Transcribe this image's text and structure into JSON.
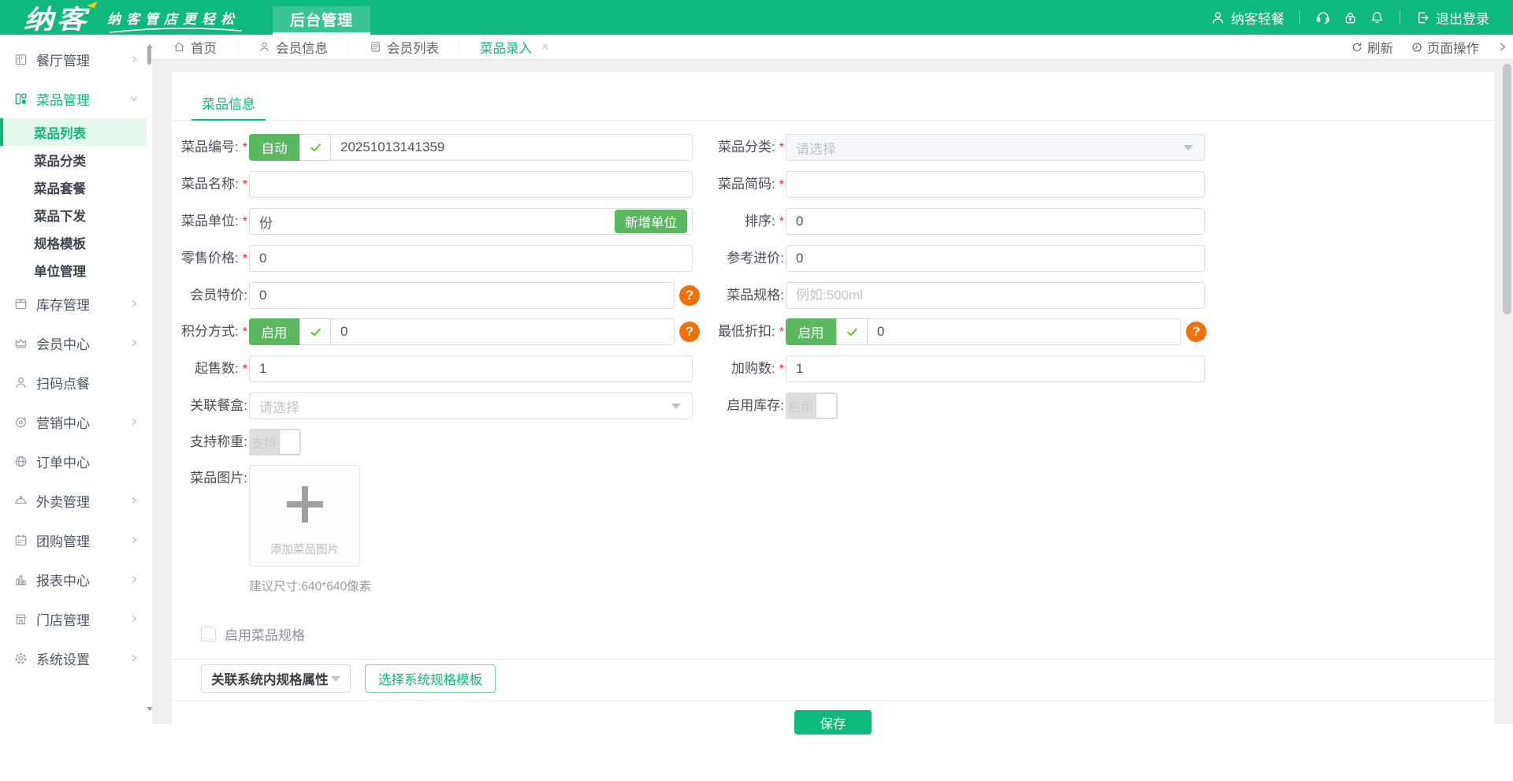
{
  "header": {
    "logo_text": "纳客",
    "tagline": "纳客管店更轻松",
    "nav_tab": "后台管理",
    "account_name": "纳客轻餐",
    "logout_label": "退出登录"
  },
  "sidebar": {
    "items": [
      {
        "label": "餐厅管理"
      },
      {
        "label": "菜品管理"
      },
      {
        "label": "库存管理"
      },
      {
        "label": "会员中心"
      },
      {
        "label": "扫码点餐"
      },
      {
        "label": "营销中心"
      },
      {
        "label": "订单中心"
      },
      {
        "label": "外卖管理"
      },
      {
        "label": "团购管理"
      },
      {
        "label": "报表中心"
      },
      {
        "label": "门店管理"
      },
      {
        "label": "系统设置"
      }
    ],
    "dish_submenu": [
      {
        "label": "菜品列表",
        "active": true
      },
      {
        "label": "菜品分类"
      },
      {
        "label": "菜品套餐"
      },
      {
        "label": "菜品下发"
      },
      {
        "label": "规格模板"
      },
      {
        "label": "单位管理"
      }
    ]
  },
  "tabbar": {
    "tabs": [
      {
        "label": "首页"
      },
      {
        "label": "会员信息"
      },
      {
        "label": "会员列表"
      },
      {
        "label": "菜品录入",
        "active": true
      }
    ],
    "refresh_label": "刷新",
    "page_ops_label": "页面操作"
  },
  "form": {
    "section_tab": "菜品信息",
    "required_marker": "*",
    "fields": {
      "code": {
        "label": "菜品编号:",
        "required": true,
        "auto_btn": "自动",
        "value": "20251013141359"
      },
      "category": {
        "label": "菜品分类:",
        "required": true,
        "placeholder": "请选择"
      },
      "name": {
        "label": "菜品名称:",
        "required": true,
        "value": ""
      },
      "short_code": {
        "label": "菜品简码:",
        "required": true,
        "value": ""
      },
      "unit": {
        "label": "菜品单位:",
        "required": true,
        "value": "份",
        "add_btn": "新增单位"
      },
      "sort": {
        "label": "排序:",
        "required": true,
        "value": "0"
      },
      "retail_price": {
        "label": "零售价格:",
        "required": true,
        "value": "0"
      },
      "ref_price": {
        "label": "参考进价:",
        "required": false,
        "value": "0"
      },
      "member_price": {
        "label": "会员特价:",
        "required": false,
        "value": "0"
      },
      "spec": {
        "label": "菜品规格:",
        "required": false,
        "placeholder": "例如:500ml"
      },
      "points": {
        "label": "积分方式:",
        "required": true,
        "toggle_btn": "启用",
        "value": "0"
      },
      "min_discount": {
        "label": "最低折扣:",
        "required": true,
        "toggle_btn": "启用",
        "value": "0"
      },
      "min_sale": {
        "label": "起售数:",
        "required": true,
        "value": "1"
      },
      "add_qty": {
        "label": "加购数:",
        "required": true,
        "value": "1"
      },
      "box": {
        "label": "关联餐盒:",
        "required": false,
        "placeholder": "请选择"
      },
      "stock": {
        "label": "启用库存:",
        "required": false,
        "toggle_text": "启用",
        "on": false
      },
      "weigh": {
        "label": "支持称重:",
        "required": false,
        "toggle_text": "支持",
        "on": false
      },
      "image": {
        "label": "菜品图片:",
        "required": false,
        "upload_text": "添加菜品图片",
        "hint": "建议尺寸:640*640像素"
      }
    },
    "enable_spec_checkbox": "启用菜品规格",
    "spec_attr_select": "关联系统内规格属性",
    "spec_template_btn": "选择系统规格模板",
    "save_btn": "保存"
  },
  "icons": {
    "close": "×",
    "question_mark": "?"
  },
  "colors": {
    "brand_green": "#0fb87e",
    "button_green": "#5cb761",
    "save_green": "#0cba7b",
    "active_item_bg": "#e4f8ec",
    "warning_orange": "#f2700c",
    "required_red": "#f5222d"
  }
}
